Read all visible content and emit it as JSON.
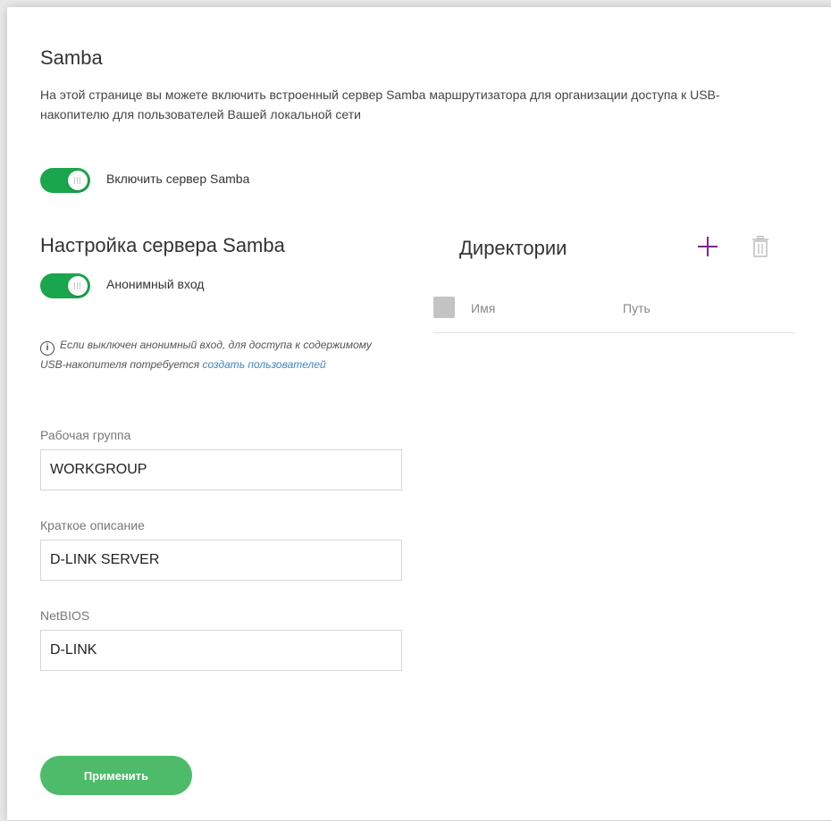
{
  "page": {
    "title": "Samba",
    "description": "На этой странице вы можете включить встроенный сервер Samba маршрутизатора для организации доступа к USB-накопителю для пользователей Вашей локальной сети"
  },
  "enable_samba": {
    "label": "Включить сервер Samba",
    "enabled": true
  },
  "server_settings": {
    "title": "Настройка сервера Samba",
    "anonymous": {
      "label": "Анонимный вход",
      "enabled": true
    },
    "info": {
      "text": "Если выключен анонимный вход, для доступа к содержимому USB-накопителя потребуется ",
      "link": "создать пользователей"
    },
    "workgroup": {
      "label": "Рабочая группа",
      "value": "WORKGROUP"
    },
    "description": {
      "label": "Краткое описание",
      "value": "D-LINK SERVER"
    },
    "netbios": {
      "label": "NetBIOS",
      "value": "D-LINK"
    },
    "apply_label": "Применить"
  },
  "directories": {
    "title": "Директории",
    "columns": [
      "Имя",
      "Путь"
    ],
    "rows": []
  },
  "colors": {
    "toggle_on": "#1aa64c",
    "apply_button": "#4dbb6a",
    "add_icon": "#7b2a8c",
    "link": "#3b86c8"
  },
  "icons": {
    "add": "plus-icon",
    "delete": "trash-icon",
    "info": "info-icon"
  }
}
